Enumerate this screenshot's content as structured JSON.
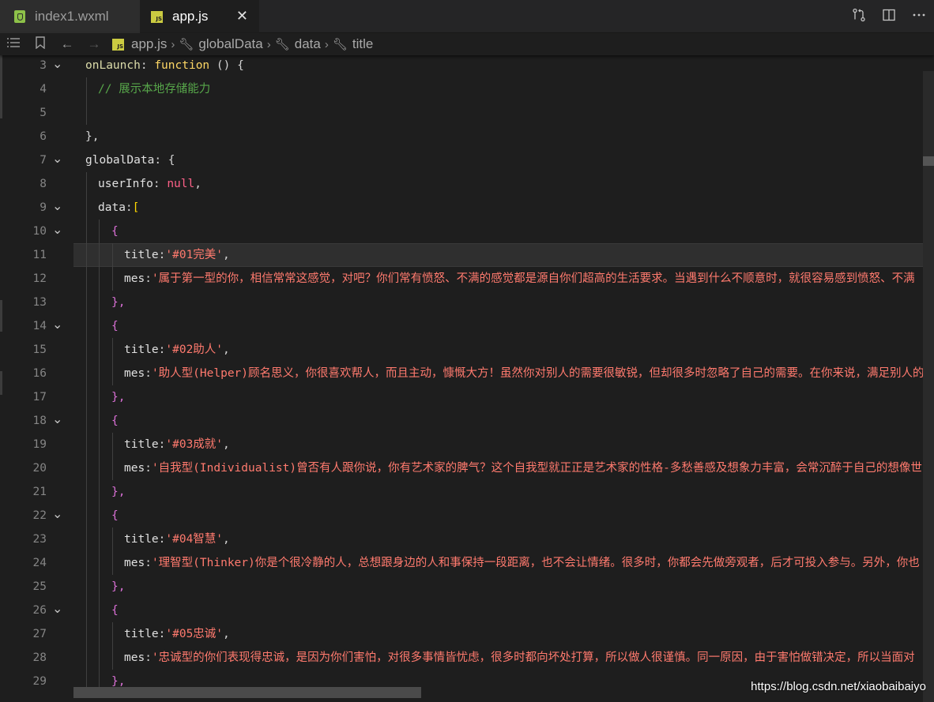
{
  "tabs": [
    {
      "label": "index1.wxml",
      "icon": "wxml-file-icon",
      "active": false
    },
    {
      "label": "app.js",
      "icon": "js-file-icon",
      "active": true
    }
  ],
  "tab_close_glyph": "✕",
  "breadcrumb": [
    "app.js",
    "globalData",
    "data",
    "title"
  ],
  "lines": [
    {
      "n": "3",
      "fold": true
    },
    {
      "n": "4",
      "fold": false
    },
    {
      "n": "5",
      "fold": false
    },
    {
      "n": "6",
      "fold": false
    },
    {
      "n": "7",
      "fold": true
    },
    {
      "n": "8",
      "fold": false
    },
    {
      "n": "9",
      "fold": true
    },
    {
      "n": "10",
      "fold": true
    },
    {
      "n": "11",
      "fold": false
    },
    {
      "n": "12",
      "fold": false
    },
    {
      "n": "13",
      "fold": false
    },
    {
      "n": "14",
      "fold": true
    },
    {
      "n": "15",
      "fold": false
    },
    {
      "n": "16",
      "fold": false
    },
    {
      "n": "17",
      "fold": false
    },
    {
      "n": "18",
      "fold": true
    },
    {
      "n": "19",
      "fold": false
    },
    {
      "n": "20",
      "fold": false
    },
    {
      "n": "21",
      "fold": false
    },
    {
      "n": "22",
      "fold": true
    },
    {
      "n": "23",
      "fold": false
    },
    {
      "n": "24",
      "fold": false
    },
    {
      "n": "25",
      "fold": false
    },
    {
      "n": "26",
      "fold": true
    },
    {
      "n": "27",
      "fold": false
    },
    {
      "n": "28",
      "fold": false
    },
    {
      "n": "29",
      "fold": false
    }
  ],
  "code": {
    "onLaunch_name": "onLaunch",
    "function_kw": "function",
    "comment": "// 展示本地存储能力",
    "globalData_name": "globalData",
    "userInfo_key": "userInfo",
    "null_kw": "null",
    "data_key": "data",
    "title_key": "title",
    "mes_key": "mes",
    "items": [
      {
        "title": "'#01完美'",
        "mes": "'属于第一型的你，相信常常这感觉，对吧？你们常有愤怒、不满的感觉都是源自你们超高的生活要求。当遇到什么不顺意时，就很容易感到愤怒、不满"
      },
      {
        "title": "'#02助人'",
        "mes": "'助人型(Helper)顾名思义，你很喜欢帮人，而且主动，慷慨大方！虽然你对别人的需要很敏锐，但却很多时忽略了自己的需要。在你来说，满足别人的"
      },
      {
        "title": "'#03成就'",
        "mes": "'自我型(Individualist)曾否有人跟你说，你有艺术家的脾气？这个自我型就正正是艺术家的性格-多愁善感及想象力丰富，会常沉醉于自己的想像世"
      },
      {
        "title": "'#04智慧'",
        "mes": "'理智型(Thinker)你是个很冷静的人，总想跟身边的人和事保持一段距离，也不会让情绪。很多时，你都会先做旁观者，后才可投入参与。另外，你也"
      },
      {
        "title": "'#05忠诚'",
        "mes": "'忠诚型的你们表现得忠诚，是因为你们害怕，对很多事情皆忧虑，很多时都向坏处打算，所以做人很谨慎。同一原因，由于害怕做错决定，所以当面对"
      }
    ]
  },
  "watermark": "https://blog.csdn.net/xiaobaibaiyo",
  "colors": {
    "background": "#1e1e1e",
    "tabbar": "#252526",
    "string": "#ff7a6e",
    "comment": "#57a64a",
    "keyword": "#ffd866",
    "null": "#ff6188",
    "bracket_gold": "#ffd700",
    "bracket_purple": "#da70d6",
    "bracket_blue": "#179fff"
  }
}
